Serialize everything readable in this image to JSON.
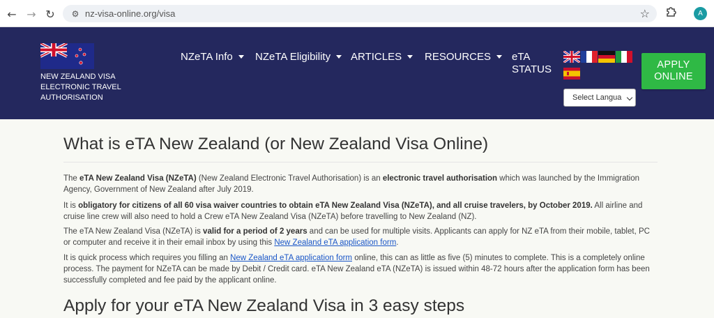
{
  "browser": {
    "url": "nz-visa-online.org/visa",
    "profile_initial": "A",
    "back_icon": "arrow-left-icon",
    "forward_icon": "arrow-right-icon",
    "reload_icon": "reload-icon"
  },
  "header": {
    "brand_lines": [
      "NEW ZEALAND VISA",
      "ELECTRONIC TRAVEL",
      "AUTHORISATION"
    ],
    "nav": [
      {
        "label": "NZeTA Info",
        "has_dropdown": true
      },
      {
        "label": "NZeTA Eligibility",
        "has_dropdown": true
      },
      {
        "label": "ARTICLES",
        "has_dropdown": true
      },
      {
        "label": "RESOURCES",
        "has_dropdown": true
      }
    ],
    "eta_status": "eTA STATUS",
    "language_select": "Select Langua",
    "apply_button": "APPLY ONLINE",
    "colors": {
      "header_bg": "#24285e",
      "apply_bg": "#2fb945"
    }
  },
  "main": {
    "title": "What is eTA New Zealand (or New Zealand Visa Online)",
    "p1": {
      "t1": "The ",
      "b1": "eTA New Zealand Visa (NZeTA)",
      "t2": " (New Zealand Electronic Travel Authorisation) is an ",
      "b2": "electronic travel authorisation",
      "t3": " which was launched by the Immigration Agency, Government of New Zealand after July 2019."
    },
    "p2": {
      "t1": "It is ",
      "b1": "obligatory for citizens of all 60 visa waiver countries to obtain eTA New Zealand Visa (NZeTA), and all cruise travelers, by October 2019.",
      "t2": " All airline and cruise line crew will also need to hold a Crew eTA New Zealand Visa (NZeTA) before travelling to New Zealand (NZ)."
    },
    "p3": {
      "t1": "The eTA New Zealand Visa (NZeTA) is ",
      "b1": "valid for a period of 2 years",
      "t2": " and can be used for multiple visits. Applicants can apply for NZ eTA from their mobile, tablet, PC or computer and receive it in their email inbox by using this ",
      "link": "New Zealand eTA application form",
      "t3": "."
    },
    "p4": {
      "t1": "It is quick process which requires you filling an ",
      "link": "New Zealand eTA application form",
      "t2": " online, this can as little as five (5) minutes to complete. This is a completely online process. The payment for NZeTA can be made by Debit / Credit card. eTA New Zealand eTA (NZeTA) is issued within 48-72 hours after the application form has been successfully completed and fee paid by the applicant online."
    },
    "subtitle": "Apply for your eTA New Zealand Visa in 3 easy steps"
  }
}
